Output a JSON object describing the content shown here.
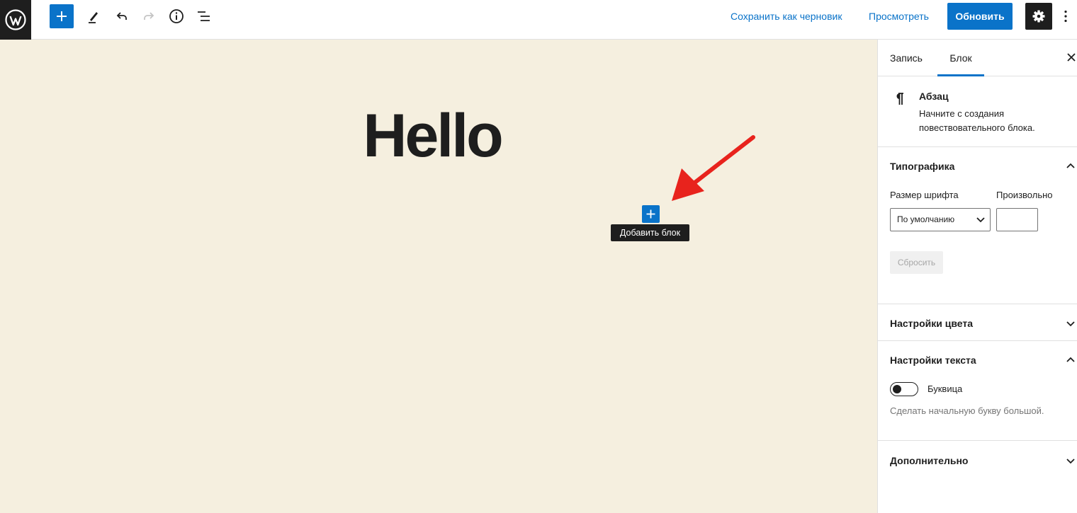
{
  "toolbar": {
    "save_draft": "Сохранить как черновик",
    "preview": "Просмотреть",
    "update": "Обновить",
    "icons": [
      "wordpress-icon",
      "plus-icon",
      "pencil-icon",
      "undo-icon",
      "redo-icon",
      "info-icon",
      "list-view-icon",
      "gear-icon",
      "more-vertical-icon"
    ]
  },
  "canvas": {
    "title": "Hello",
    "tooltip": "Добавить блок",
    "background": "#f5efdf"
  },
  "sidebar": {
    "tabs": [
      {
        "label": "Запись",
        "active": false
      },
      {
        "label": "Блок",
        "active": true
      }
    ],
    "block": {
      "name": "Абзац",
      "description_line1": "Начните с создания",
      "description_line2": "повествовательного блока."
    },
    "typography": {
      "title": "Типографика",
      "font_size_label": "Размер шрифта",
      "custom_label": "Произвольно",
      "select_value": "По умолчанию",
      "custom_value": "",
      "reset": "Сбросить"
    },
    "color_settings": {
      "title": "Настройки цвета"
    },
    "text_settings": {
      "title": "Настройки текста",
      "drop_cap_label": "Буквица",
      "drop_cap_enabled": false,
      "drop_cap_hint": "Сделать начальную букву большой."
    },
    "advanced": {
      "title": "Дополнительно"
    }
  },
  "colors": {
    "accent": "#0a73c9",
    "dark": "#1e1e1e",
    "arrow": "#e8231d"
  }
}
